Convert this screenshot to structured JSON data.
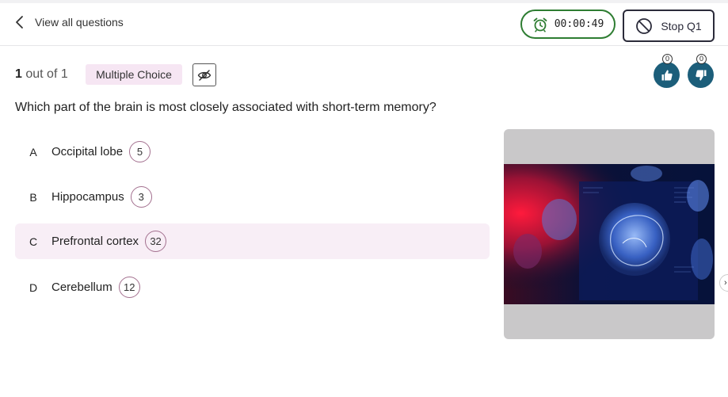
{
  "header": {
    "back_label": "View all questions",
    "timer": "00:00:49",
    "stop_label": "Stop Q1"
  },
  "progress": {
    "current": "1",
    "suffix": "out of 1"
  },
  "question_type": "Multiple Choice",
  "reactions": {
    "likes": "0",
    "dislikes": "0"
  },
  "question": "Which part of the brain is most closely associated with short-term memory?",
  "options": [
    {
      "letter": "A",
      "text": "Occipital lobe",
      "count": "5"
    },
    {
      "letter": "B",
      "text": "Hippocampus",
      "count": "3"
    },
    {
      "letter": "C",
      "text": "Prefrontal cortex",
      "count": "32",
      "selected": true
    },
    {
      "letter": "D",
      "text": "Cerebellum",
      "count": "12"
    }
  ],
  "colors": {
    "accent_teal": "#1c5e7a",
    "timer_green": "#2e7d32",
    "badge_pink": "#f6e6f3",
    "selected_bg": "#f8eef6",
    "count_border": "#a3708f"
  },
  "icons": {
    "back": "chevron-left-icon",
    "timer": "alarm-clock-icon",
    "stop": "no-entry-icon",
    "hide": "eye-slash-icon",
    "like": "thumbs-up-icon",
    "dislike": "thumbs-down-icon"
  }
}
